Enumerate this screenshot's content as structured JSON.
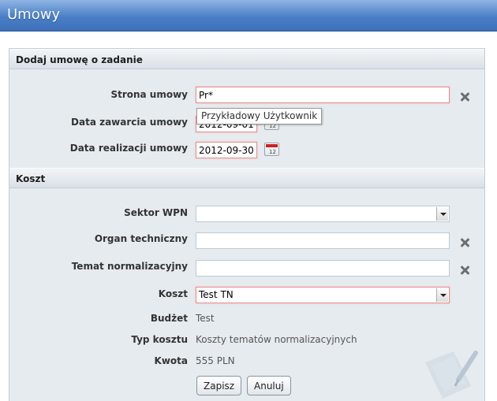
{
  "window": {
    "title": "Umowy"
  },
  "sections": {
    "add_contract": "Dodaj umowę o zadanie",
    "cost": "Koszt"
  },
  "form": {
    "strona_umowy": {
      "label": "Strona umowy",
      "value": "Pr*",
      "suggestion": "Przykładowy Użytkownik"
    },
    "data_zawarcia": {
      "label": "Data zawarcia umowy",
      "value": "2012-09-01"
    },
    "data_realizacji": {
      "label": "Data realizacji umowy",
      "value": "2012-09-30"
    },
    "sektor_wpn": {
      "label": "Sektor WPN",
      "value": ""
    },
    "organ_techniczny": {
      "label": "Organ techniczny",
      "value": ""
    },
    "temat_normalizacyjny": {
      "label": "Temat normalizacyjny",
      "value": ""
    },
    "koszt": {
      "label": "Koszt",
      "value": "Test TN"
    },
    "budzet": {
      "label": "Budżet",
      "value": "Test"
    },
    "typ_kosztu": {
      "label": "Typ kosztu",
      "value": "Koszty tematów normalizacyjnych"
    },
    "kwota": {
      "label": "Kwota",
      "value": "555 PLN"
    }
  },
  "buttons": {
    "save": "Zapisz",
    "cancel": "Anuluj"
  },
  "colors": {
    "title_bar": "#4a7fc7",
    "error_border": "#e88e8e",
    "panel_bg": "#e6ebef"
  },
  "icons": [
    "clear-icon",
    "calendar-icon",
    "dropdown-arrow-icon"
  ]
}
